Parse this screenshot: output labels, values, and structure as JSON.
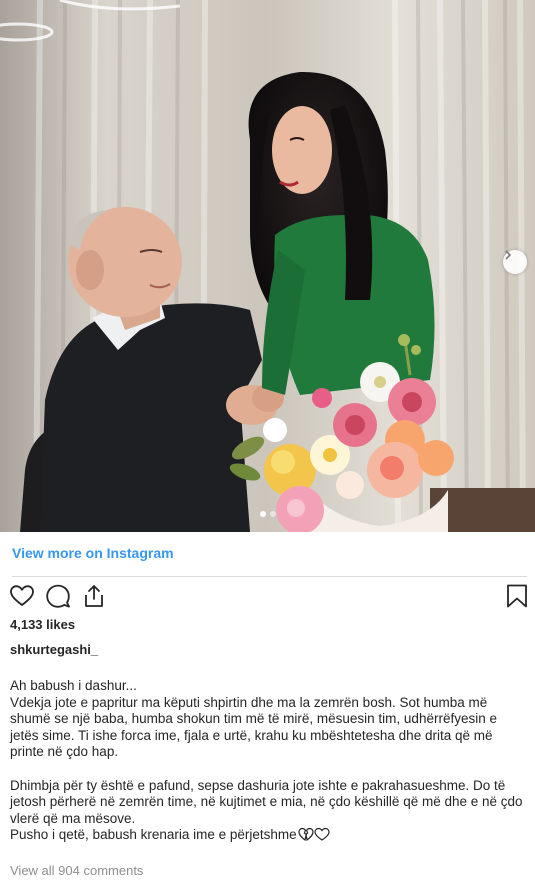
{
  "post": {
    "view_more_label": "View more on Instagram",
    "likes": "4,133 likes",
    "username": "shkurtegashi_",
    "view_comments": "View all 904 comments",
    "carousel": {
      "slide_count": 2,
      "active_slide": 1
    }
  },
  "caption": {
    "line1": "Ah babush i dashur...",
    "paragraph1": "Vdekja jote e papritur ma këputi shpirtin dhe ma la zemrën bosh. Sot humba më shumë se një baba, humba shokun tim më të mirë, mësuesin tim, udhërrëfyesin e jetës sime. Ti ishe forca ime, fjala e urtë, krahu ku mbështetesha dhe drita që më printe në çdo hap.",
    "paragraph2": "Dhimbja për ty është e pafund, sepse dashuria jote ishte e pakrahasueshme. Do të jetosh përherë në zemrën time, në kujtimet e mia, në çdo këshillë që më dhe e në çdo vlerë që ma mësove.",
    "last_line": "Pusho i qetë, babush krenaria ime e përjetshme"
  },
  "icons": {
    "like": "heart-outline-icon",
    "comment": "speech-bubble-icon",
    "share": "share-upload-icon",
    "save": "bookmark-icon",
    "next": "chevron-right-icon",
    "caption_emoji": "broken-heart-and-white-heart-emoji"
  },
  "colors": {
    "link_blue": "#3897f0",
    "text": "#262626",
    "muted": "#8e8e8e",
    "dress_green": "#1f7a3c"
  }
}
